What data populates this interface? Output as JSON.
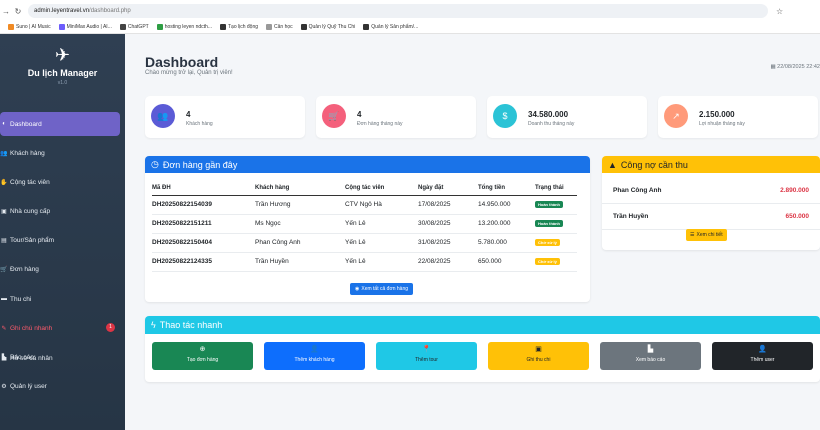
{
  "browser": {
    "url_host": "admin.leyentravel.vn",
    "url_path": "/dashboard.php",
    "bookmarks": [
      {
        "label": "Suno | AI Music",
        "color": "#f08a24"
      },
      {
        "label": "MiniMax Audio | AI...",
        "color": "#6d5dfc"
      },
      {
        "label": "ChatGPT",
        "color": "#444444"
      },
      {
        "label": "hosting leyen ndcth...",
        "color": "#2e9e44"
      },
      {
        "label": "Tạo lịch động",
        "color": "#333333"
      },
      {
        "label": "Cân học",
        "color": "#999999"
      },
      {
        "label": "Quản lý Quỹ Thu Chi",
        "color": "#333333"
      },
      {
        "label": "Quản lý Sản phẩm/...",
        "color": "#333333"
      }
    ]
  },
  "sidebar": {
    "brand": "Du lịch Manager",
    "version": "v1.0",
    "items": [
      {
        "label": "Dashboard",
        "icon": "gauge-icon"
      },
      {
        "label": "Khách hàng",
        "icon": "users-icon"
      },
      {
        "label": "Cộng tác viên",
        "icon": "handshake-icon"
      },
      {
        "label": "Nhà cung cấp",
        "icon": "truck-icon"
      },
      {
        "label": "Tour/Sản phẩm",
        "icon": "map-icon"
      },
      {
        "label": "Đơn hàng",
        "icon": "cart-icon"
      },
      {
        "label": "Thu chi",
        "icon": "wallet-icon"
      },
      {
        "label": "Ghi chú nhanh",
        "icon": "note-icon",
        "badge": "1"
      },
      {
        "label": "Báo cáo",
        "icon": "chart-icon"
      },
      {
        "label": "Quản lý user",
        "icon": "user-cog-icon"
      }
    ],
    "profile": "Hồ sơ cá nhân"
  },
  "header": {
    "title": "Dashboard",
    "subtitle": "Chào mừng trở lại, Quản trị viên!",
    "datetime": "22/08/2025 22:42"
  },
  "stats": [
    {
      "value": "4",
      "label": "Khách hàng",
      "icon": "users-icon",
      "color": "#5b5bd6"
    },
    {
      "value": "4",
      "label": "Đơn hàng tháng này",
      "icon": "cart-icon",
      "color": "#f4607c"
    },
    {
      "value": "34.580.000",
      "label": "Doanh thu tháng này",
      "icon": "dollar-icon",
      "color": "#2bc3d6"
    },
    {
      "value": "2.150.000",
      "label": "Lợi nhuận tháng này",
      "icon": "trend-icon",
      "color": "#ff9a7a"
    }
  ],
  "orders": {
    "title": "Đơn hàng gần đây",
    "columns": [
      "Mã ĐH",
      "Khách hàng",
      "Cộng tác viên",
      "Ngày đặt",
      "Tổng tiền",
      "Trạng thái"
    ],
    "rows": [
      {
        "code": "DH20250822154039",
        "customer": "Trần Hương",
        "collab": "CTV Ngô Hà",
        "date": "17/08/2025",
        "total": "14.950.000",
        "status": "Hoàn thành",
        "kind": "done"
      },
      {
        "code": "DH20250822151211",
        "customer": "Ms Ngọc",
        "collab": "Yến Lê",
        "date": "30/08/2025",
        "total": "13.200.000",
        "status": "Hoàn thành",
        "kind": "done"
      },
      {
        "code": "DH20250822150404",
        "customer": "Phan Công Anh",
        "collab": "Yến Lê",
        "date": "31/08/2025",
        "total": "5.780.000",
        "status": "Chờ xử lý",
        "kind": "wait"
      },
      {
        "code": "DH20250822124335",
        "customer": "Trần Huyền",
        "collab": "Yến Lê",
        "date": "22/08/2025",
        "total": "650.000",
        "status": "Chờ xử lý",
        "kind": "wait"
      }
    ],
    "view_all": "Xem tất cả đơn hàng"
  },
  "debt": {
    "title": "Công nợ cần thu",
    "rows": [
      {
        "name": "Phan Công Anh",
        "amount": "2.890.000"
      },
      {
        "name": "Trần Huyền",
        "amount": "650.000"
      }
    ],
    "detail": "Xem chi tiết"
  },
  "quick": {
    "title": "Thao tác nhanh",
    "buttons": [
      {
        "label": "Tạo đơn hàng",
        "icon": "plus-circle-icon",
        "color": "#198754"
      },
      {
        "label": "Thêm khách hàng",
        "icon": "user-plus-icon",
        "color": "#0d6efd"
      },
      {
        "label": "Thêm tour",
        "icon": "map-pin-icon",
        "color": "#1fc8e6"
      },
      {
        "label": "Ghi thu chi",
        "icon": "money-icon",
        "color": "#ffc107"
      },
      {
        "label": "Xem báo cáo",
        "icon": "chart-icon",
        "color": "#6c757d"
      },
      {
        "label": "Thêm user",
        "icon": "user-add-icon",
        "color": "#212529"
      }
    ]
  }
}
